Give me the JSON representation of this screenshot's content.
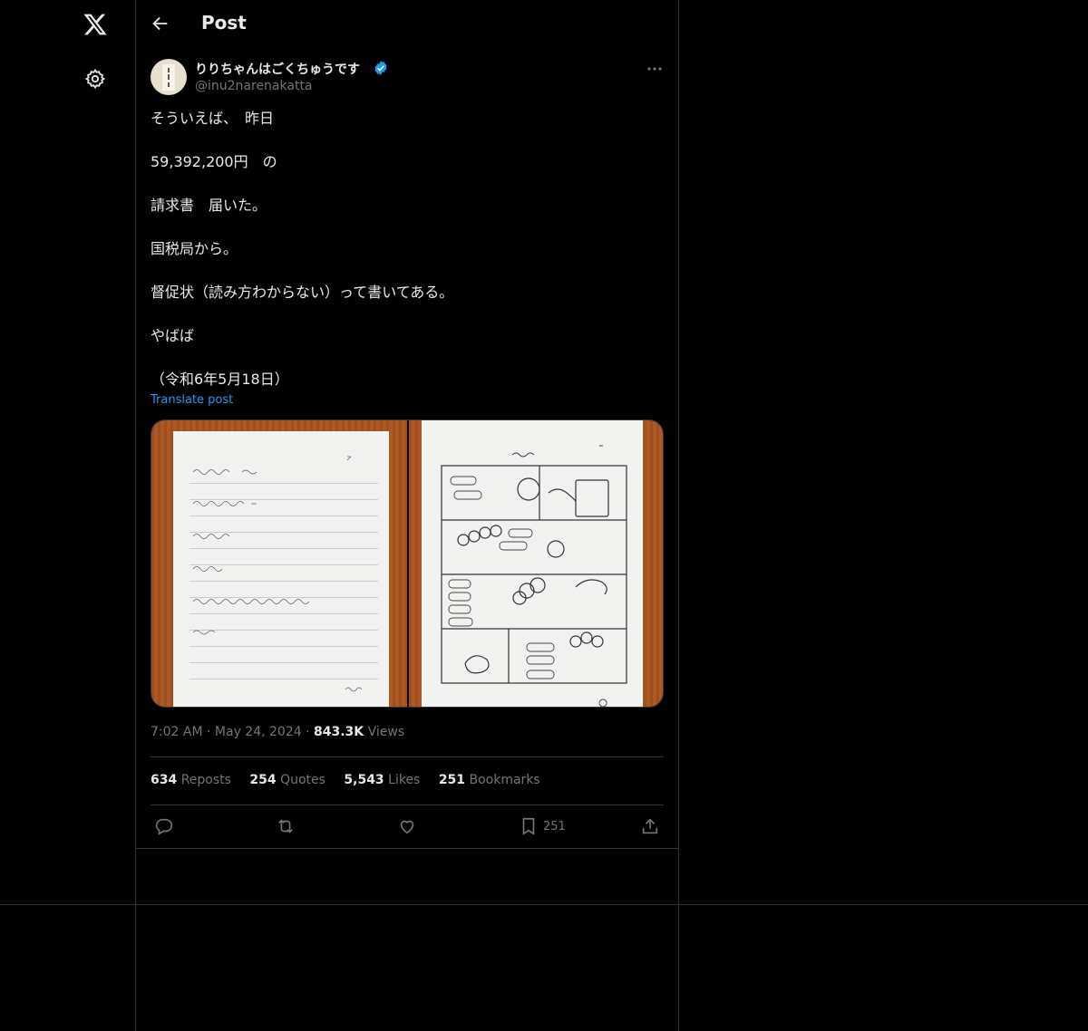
{
  "nav": {
    "logo_icon": "x-logo-icon",
    "settings_icon": "gear-icon"
  },
  "header": {
    "title": "Post",
    "back_icon": "arrow-left-icon"
  },
  "post": {
    "author": {
      "display_name": "りりちゃんはごくちゅうです",
      "handle": "@inu2narenakatta",
      "verified": true,
      "verified_color": "#1d9bf0"
    },
    "lines": [
      "そういえば、　昨日",
      "59,392,200円　の",
      "請求書　届いた。",
      "国税局から。",
      "督促状（読み方わからない）って書いてある。",
      "やばば",
      "（令和6年5月18日）"
    ],
    "translate_label": "Translate post",
    "time": "7:02 AM",
    "date": "May 24, 2024",
    "views_count": "843.3K",
    "views_label": "Views",
    "stats": {
      "reposts_count": "634",
      "reposts_label": "Reposts",
      "quotes_count": "254",
      "quotes_label": "Quotes",
      "likes_count": "5,543",
      "likes_label": "Likes",
      "bookmarks_count": "251",
      "bookmarks_label": "Bookmarks"
    },
    "actions": {
      "bookmark_count": "251"
    }
  },
  "colors": {
    "background": "#000000",
    "text": "#e7e9ea",
    "muted": "#71767b",
    "accent": "#1d9bf0",
    "border": "#2f3336"
  }
}
